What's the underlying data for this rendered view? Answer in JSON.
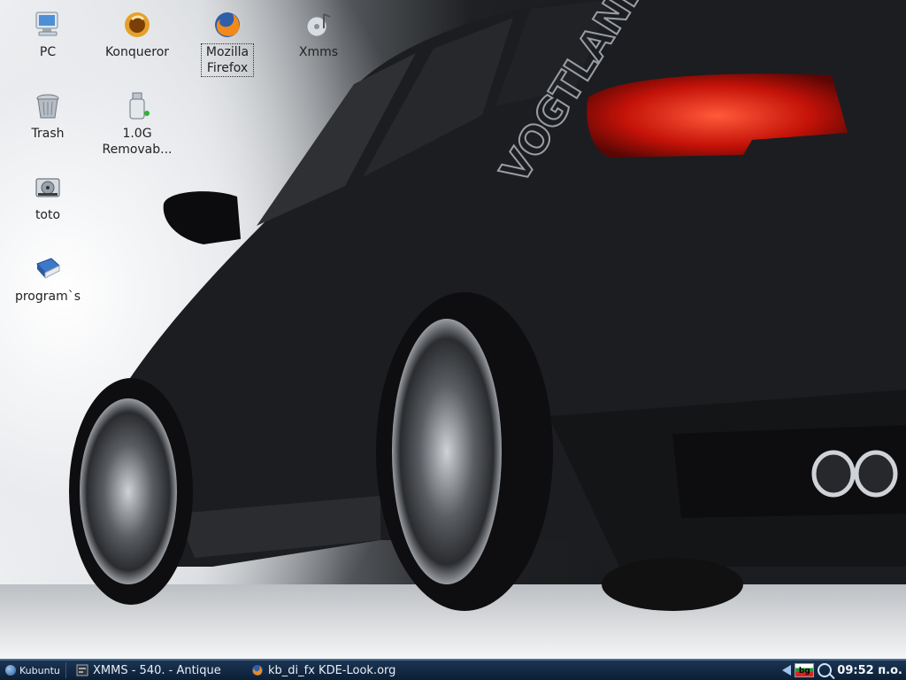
{
  "desktop": {
    "icons": [
      {
        "label": "PC",
        "icon": "computer-icon"
      },
      {
        "label": "Konqueror",
        "icon": "konqueror-icon"
      },
      {
        "label": "Mozilla Firefox",
        "icon": "firefox-icon",
        "selected": true
      },
      {
        "label": "Xmms",
        "icon": "xmms-icon"
      },
      {
        "label": "Trash",
        "icon": "trash-icon"
      },
      {
        "label": "1.0G Removab...",
        "icon": "usb-drive-icon"
      },
      {
        "label": "toto",
        "icon": "hard-disk-icon"
      },
      {
        "label": "program`s",
        "icon": "book-icon"
      }
    ]
  },
  "wallpaper": {
    "brand_text": "VOGTLAND",
    "colors": {
      "car_body": "#1c1d20",
      "taillight": "#d4170f"
    }
  },
  "taskbar": {
    "menu_label": "Kubuntu",
    "tasks": [
      {
        "label": "XMMS - 540.  - Antique",
        "icon": "xmms-task-icon"
      },
      {
        "label": "kb_di_fx KDE-Look.org",
        "icon": "firefox-task-icon"
      }
    ],
    "tray": {
      "keyboard_layout": "bg",
      "clock": "09:52 п.о."
    },
    "colors": {
      "bar": "#0c1f36",
      "accent": "#4d6c8f"
    }
  }
}
